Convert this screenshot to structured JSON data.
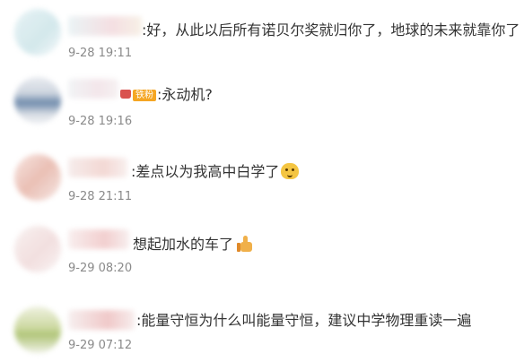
{
  "comments": [
    {
      "text": ":好，从此以后所有诺贝尔奖就归你了，地球的未来就靠你了",
      "time": "9-28 19:11"
    },
    {
      "badge": "铁粉",
      "text": ":永动机?",
      "time": "9-28 19:16"
    },
    {
      "text": ":差点以为我高中白学了",
      "emoji": "doge-face-icon",
      "time": "9-28 21:11"
    },
    {
      "text": "想起加水的车了",
      "emoji": "thumbs-up-icon",
      "time": "9-29 08:20"
    },
    {
      "text": ":能量守恒为什么叫能量守恒，建议中学物理重读一遍",
      "time": "9-29 07:12"
    }
  ]
}
